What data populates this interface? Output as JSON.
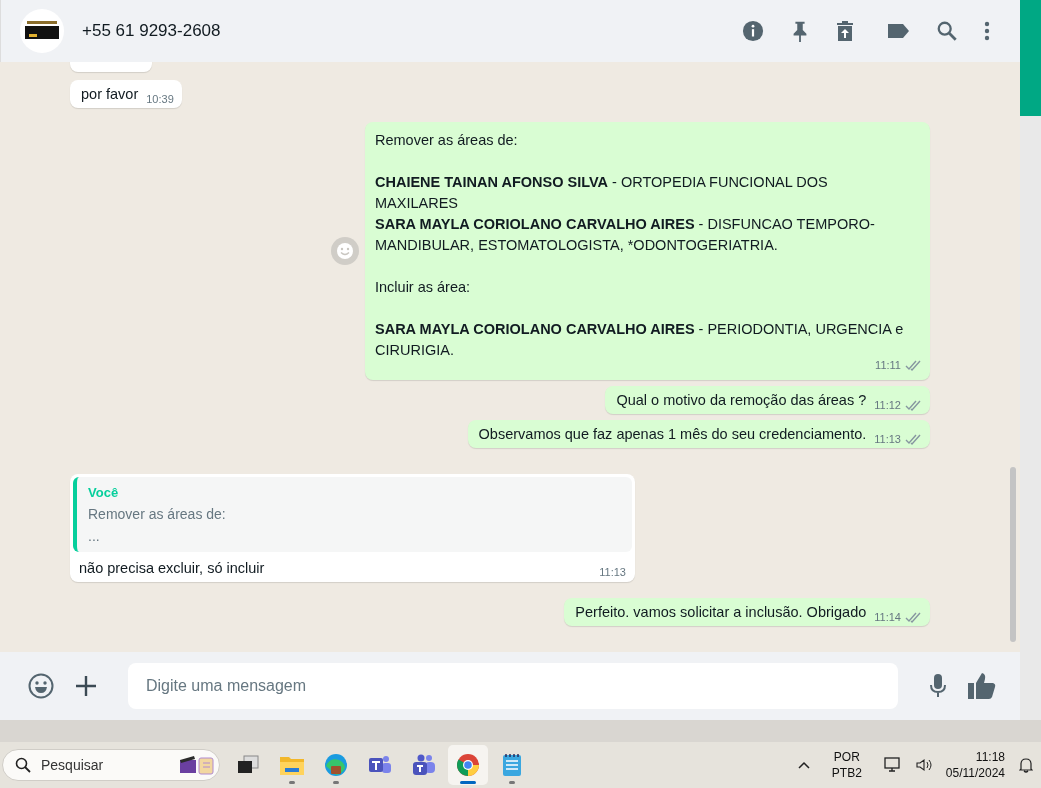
{
  "header": {
    "contact": "+55 61 9293-2608"
  },
  "messages": [
    {
      "kind": "stub",
      "outgoing": false
    },
    {
      "kind": "text",
      "outgoing": false,
      "text": "por favor",
      "time": "10:39"
    },
    {
      "kind": "blocks",
      "outgoing": true,
      "reaction_button": true,
      "blocks": [
        [
          "Remover as áreas de:"
        ],
        [
          "**CHAIENE TAINAN AFONSO SILVA** - ORTOPEDIA FUNCIONAL DOS MAXILARES",
          "**SARA MAYLA CORIOLANO CARVALHO AIRES** - DISFUNCAO TEMPORO-MANDIBULAR, ESTOMATOLOGISTA, *ODONTOGERIATRIA."
        ],
        [
          "Incluir as área:"
        ],
        [
          "**SARA MAYLA CORIOLANO CARVALHO AIRES** - PERIODONTIA, URGENCIA e CIRURIGIA."
        ]
      ],
      "time": "11:11",
      "read": false
    },
    {
      "kind": "text",
      "outgoing": true,
      "text": "Qual o motivo da remoção das áreas ?",
      "time": "11:12",
      "read": false
    },
    {
      "kind": "text",
      "outgoing": true,
      "text": "Observamos que faz apenas 1 mês do seu credenciamento.",
      "time": "11:13",
      "read": false
    },
    {
      "kind": "reply",
      "outgoing": false,
      "quote": {
        "author": "Você",
        "lines": [
          "Remover as áreas de:",
          "..."
        ]
      },
      "text": "não precisa excluir, só incluir",
      "time": "11:13"
    },
    {
      "kind": "text",
      "outgoing": true,
      "text": "Perfeito. vamos solicitar a inclusão. Obrigado",
      "time": "11:14",
      "read": false
    }
  ],
  "composer": {
    "placeholder": "Digite uma mensagem"
  },
  "taskbar": {
    "search": {
      "placeholder": "Pesquisar"
    },
    "apps": [
      {
        "kind": "taskview",
        "selected": false,
        "running": false
      },
      {
        "kind": "folder",
        "selected": false,
        "running": true
      },
      {
        "kind": "edge",
        "selected": false,
        "running": true
      },
      {
        "kind": "teams-classic",
        "selected": false,
        "running": false
      },
      {
        "kind": "teams",
        "selected": false,
        "running": false
      },
      {
        "kind": "chrome",
        "selected": true,
        "running": true
      },
      {
        "kind": "notepad",
        "selected": false,
        "running": true
      }
    ],
    "language": [
      "POR",
      "PTB2"
    ],
    "time": "11:18",
    "date": "05/11/2024"
  }
}
